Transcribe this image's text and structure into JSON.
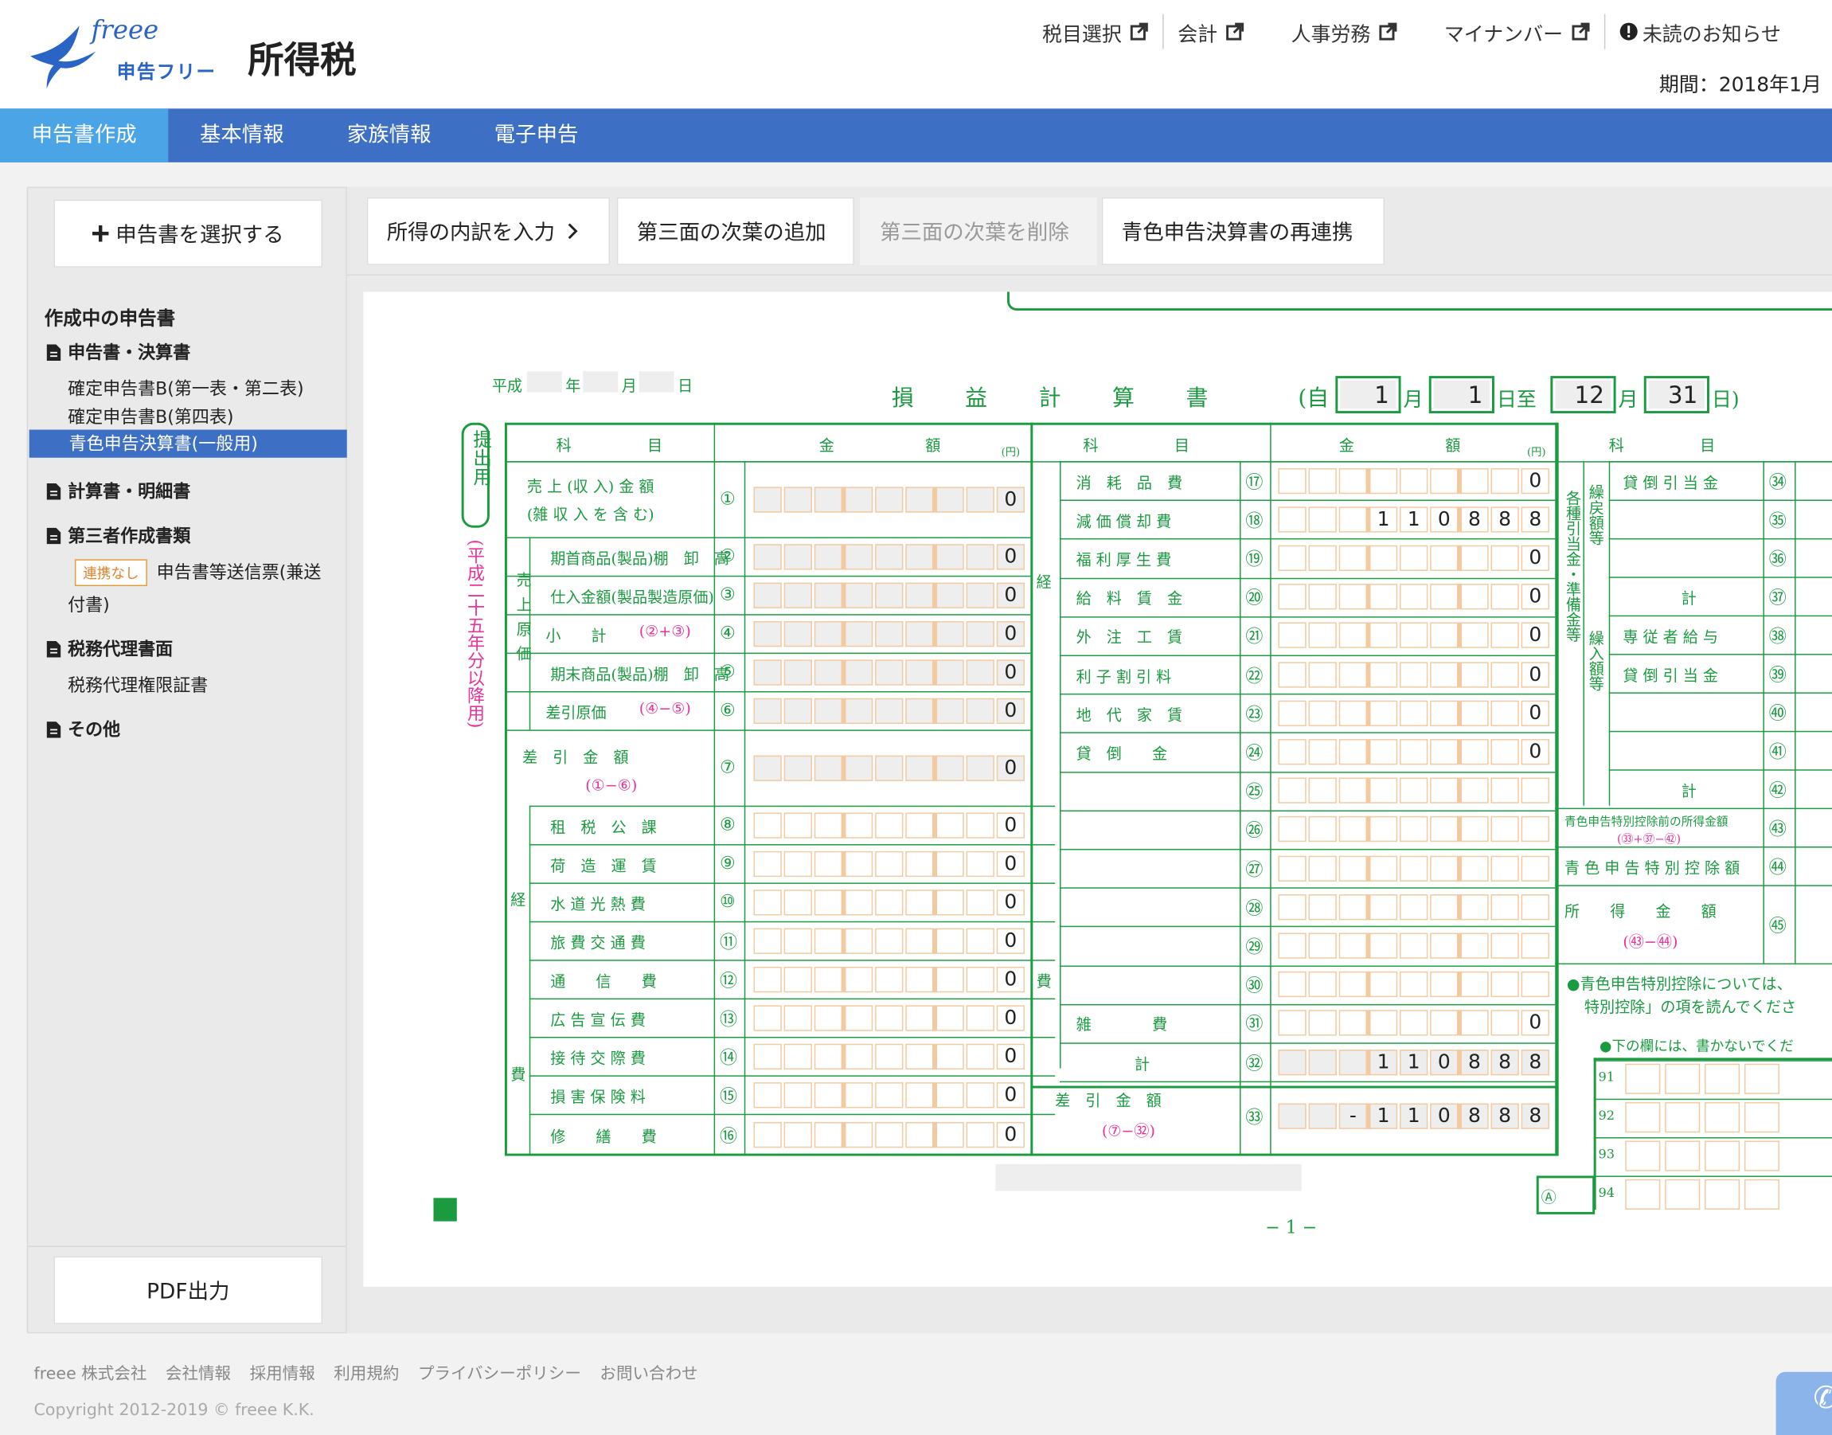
{
  "header": {
    "logo_script": "freee",
    "logo_text": "申告フリー",
    "app_title": "所得税",
    "links": [
      "税目選択",
      "会計",
      "人事労務",
      "マイナンバー"
    ],
    "notice": "未読のお知らせ",
    "period": "期間：2018年1月"
  },
  "tabs": [
    {
      "label": "申告書作成"
    },
    {
      "label": "基本情報"
    },
    {
      "label": "家族情報"
    },
    {
      "label": "電子申告"
    }
  ],
  "sidebar": {
    "select_button": "申告書を選択する",
    "section_title": "作成中の申告書",
    "cat1": "申告書・決算書",
    "items": [
      "確定申告書B(第一表・第二表)",
      "確定申告書B(第四表)",
      "青色申告決算書(一般用)"
    ],
    "cat2": "計算書・明細書",
    "cat3": "第三者作成書類",
    "badge": "連携なし",
    "third_item_1": "申告書等送信票(兼送",
    "third_item_2": "付書)",
    "cat4": "税務代理書面",
    "agent_item": "税務代理権限証書",
    "cat5": "その他",
    "pdf_button": "PDF出力"
  },
  "toolbar": {
    "b1": "所得の内訳を入力",
    "b2": "第三面の次葉の追加",
    "b3": "第三面の次葉を削除",
    "b4": "青色申告決算書の再連携"
  },
  "form": {
    "heisei": "平成",
    "nen": "年",
    "tsuki": "月",
    "hi": "日",
    "title": "損　　益　　計　　算　　書",
    "period_from": "(自",
    "m1": "1",
    "d1": "1",
    "shi": "日至",
    "m2": "12",
    "d2": "31",
    "period_end": "日)",
    "mon": "月",
    "teishutsu": "提出用",
    "edition": "(平成二十五年分以降用)",
    "col_kamoku": "科　　　　　目",
    "col_kingaku": "金　　　　　　額",
    "col_en": "(円)",
    "g_uriage_genka": "売上原価",
    "g_keihi": "経",
    "g_hi": "費",
    "g_hi2": "費",
    "left_rows": [
      {
        "label": "売 上 (収 入) 金 額",
        "label2": "(雑 収 入 を 含 む)",
        "num": "①",
        "value": "0"
      },
      {
        "label": "期首商品(製品)棚　卸　高",
        "num": "②",
        "value": "0"
      },
      {
        "label": "仕入金額(製品製造原価)",
        "num": "③",
        "value": "0"
      },
      {
        "label": "小　　計",
        "calc": "(②+③)",
        "num": "④",
        "value": "0"
      },
      {
        "label": "期末商品(製品)棚　卸　高",
        "num": "⑤",
        "value": "0"
      },
      {
        "label": "差引原価",
        "calc": "(④−⑤)",
        "num": "⑥",
        "value": "0"
      },
      {
        "label": "差　引　金　額",
        "calc": "(①−⑥)",
        "num": "⑦",
        "value": "0"
      },
      {
        "label": "租　税　公　課",
        "num": "⑧",
        "value": "0"
      },
      {
        "label": "荷　造　運　賃",
        "num": "⑨",
        "value": "0"
      },
      {
        "label": "水 道 光 熱 費",
        "num": "⑩",
        "value": "0"
      },
      {
        "label": "旅 費 交 通 費",
        "num": "⑪",
        "value": "0"
      },
      {
        "label": "通　　信　　費",
        "num": "⑫",
        "value": "0"
      },
      {
        "label": "広 告 宣 伝 費",
        "num": "⑬",
        "value": "0"
      },
      {
        "label": "接 待 交 際 費",
        "num": "⑭",
        "value": "0"
      },
      {
        "label": "損 害 保 険 料",
        "num": "⑮",
        "value": "0"
      },
      {
        "label": "修　　繕　　費",
        "num": "⑯",
        "value": "0"
      }
    ],
    "mid_rows": [
      {
        "label": "消　耗　品　費",
        "num": "⑰",
        "value": "0"
      },
      {
        "label": "減 価 償 却 費",
        "num": "⑱",
        "value": "110888"
      },
      {
        "label": "福 利 厚 生 費",
        "num": "⑲",
        "value": "0"
      },
      {
        "label": "給　料　賃　金",
        "num": "⑳",
        "value": "0"
      },
      {
        "label": "外　注　工　賃",
        "num": "㉑",
        "value": "0"
      },
      {
        "label": "利 子 割 引 料",
        "num": "㉒",
        "value": "0"
      },
      {
        "label": "地　代　家　賃",
        "num": "㉓",
        "value": "0"
      },
      {
        "label": "貸　倒　　金",
        "num": "㉔",
        "value": "0"
      },
      {
        "label": "",
        "num": "㉕",
        "value": ""
      },
      {
        "label": "",
        "num": "㉖",
        "value": ""
      },
      {
        "label": "",
        "num": "㉗",
        "value": ""
      },
      {
        "label": "",
        "num": "㉘",
        "value": ""
      },
      {
        "label": "",
        "num": "㉙",
        "value": ""
      },
      {
        "label": "",
        "num": "㉚",
        "value": ""
      },
      {
        "label": "雑　　　　費",
        "num": "㉛",
        "value": "0"
      },
      {
        "label": "計",
        "num": "㉜",
        "value": "110888"
      },
      {
        "label": "差　引　金　額",
        "calc": "(⑦−㉜)",
        "num": "㉝",
        "value": "-110888"
      }
    ],
    "right_rows": [
      {
        "label": "貸 倒 引 当 金",
        "num": "㉞"
      },
      {
        "label": "",
        "num": "㉟"
      },
      {
        "label": "",
        "num": "㊱"
      },
      {
        "label": "計",
        "num": "㊲"
      },
      {
        "label": "専 従 者 給 与",
        "num": "㊳"
      },
      {
        "label": "貸 倒 引 当 金",
        "num": "㊴"
      },
      {
        "label": "",
        "num": "㊵"
      },
      {
        "label": "",
        "num": "㊶"
      },
      {
        "label": "計",
        "num": "㊷"
      },
      {
        "label": "青色申告特別控除前の所得金額",
        "calc": "(㉝+㊲−㊷)",
        "num": "㊸"
      },
      {
        "label": "青 色 申 告 特 別 控 除 額",
        "num": "㊹"
      },
      {
        "label": "所　　得　　金　　額",
        "calc": "(㊸−㊹)",
        "num": "㊺"
      }
    ],
    "r_group1": "各種引当金・準備金等",
    "r_sub1": "繰戻額等",
    "r_sub2": "繰入額等",
    "note1": "●青色申告特別控除については、",
    "note2": "特別控除」の項を読んでくださ",
    "note3": "●下の欄には、書かないでくだ",
    "bottom_nums": [
      "91",
      "92",
      "93",
      "94"
    ],
    "a_mark": "Ⓐ",
    "page_num": "− 1 −"
  },
  "footer": {
    "links": [
      "freee 株式会社",
      "会社情報",
      "採用情報",
      "利用規約",
      "プライバシーポリシー",
      "お問い合わせ"
    ],
    "copyright": "Copyright 2012-2019 © freee K.K."
  },
  "colors": {
    "brand": "#3d6fc4",
    "tab_active": "#4aa4e6",
    "form_green": "#1a9b3f",
    "calc_pink": "#e8339a"
  }
}
